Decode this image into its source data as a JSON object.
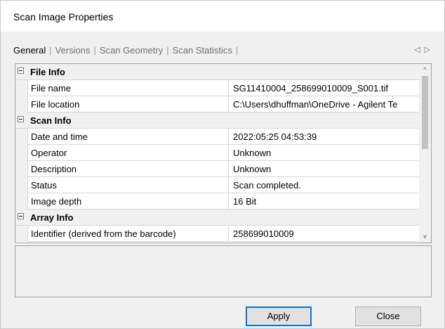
{
  "window": {
    "title": "Scan Image Properties"
  },
  "tabs": [
    {
      "label": "General"
    },
    {
      "label": "Versions"
    },
    {
      "label": "Scan Geometry"
    },
    {
      "label": "Scan Statistics"
    }
  ],
  "tab_separator": "|",
  "tab_scroll": {
    "left_glyph": "◁",
    "right_glyph": "▷"
  },
  "grid": {
    "categories": [
      {
        "label": "File Info",
        "properties": [
          {
            "name": "File name",
            "value": "SG11410004_258699010009_S001.tif"
          },
          {
            "name": "File location",
            "value": "C:\\Users\\dhuffman\\OneDrive - Agilent Te"
          }
        ]
      },
      {
        "label": "Scan Info",
        "properties": [
          {
            "name": "Date and time",
            "value": "2022:05:25 04:53:39"
          },
          {
            "name": "Operator",
            "value": "Unknown"
          },
          {
            "name": "Description",
            "value": "Unknown"
          },
          {
            "name": "Status",
            "value": "Scan completed."
          },
          {
            "name": "Image depth",
            "value": "16 Bit"
          }
        ]
      },
      {
        "label": "Array Info",
        "properties": [
          {
            "name": "Identifier (derived from the barcode)",
            "value": "258699010009"
          }
        ]
      }
    ],
    "scroll": {
      "up_glyph": "^",
      "down_glyph": "v"
    }
  },
  "buttons": {
    "apply": "Apply",
    "close": "Close"
  },
  "colors": {
    "default_button_border": "#0078d7",
    "category_row_bg": "#f0f0f0"
  }
}
